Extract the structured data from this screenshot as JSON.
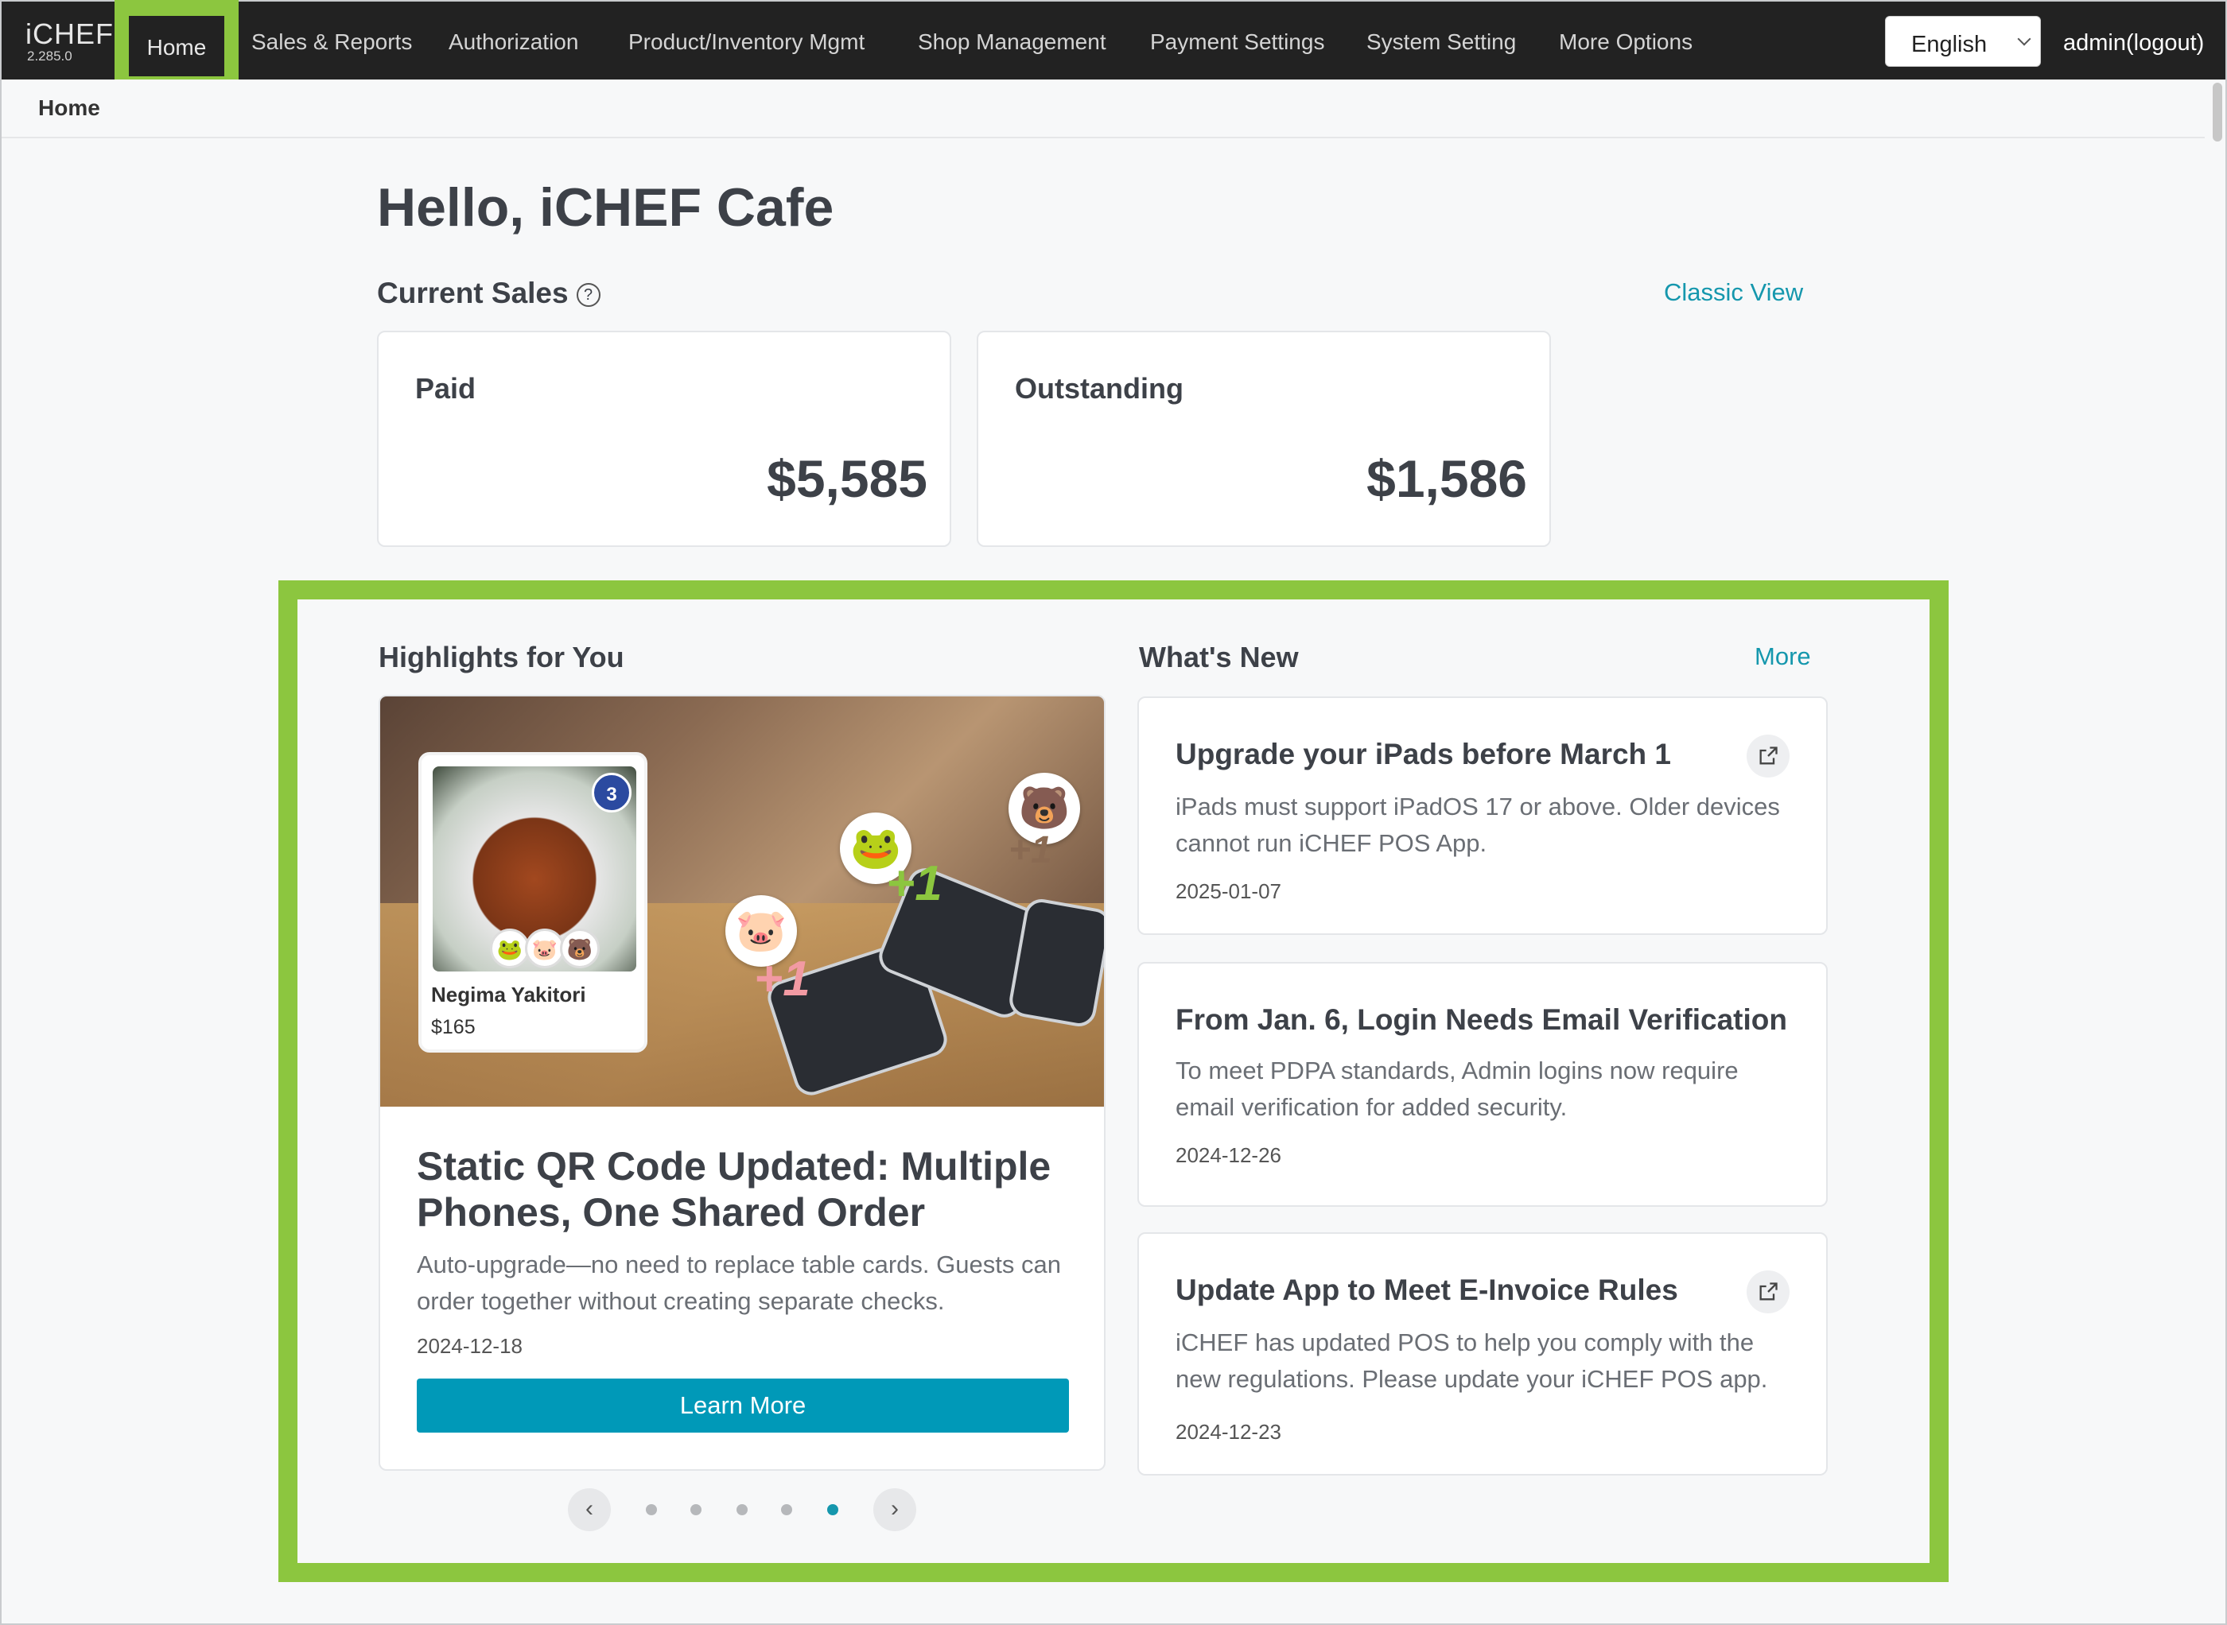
{
  "app": {
    "name": "iCHEF",
    "version": "2.285.0"
  },
  "nav": {
    "home": "Home",
    "items": [
      "Sales & Reports",
      "Authorization",
      "Product/Inventory Mgmt",
      "Shop Management",
      "Payment Settings",
      "System Setting",
      "More Options"
    ],
    "language": "English",
    "user": "admin(logout)"
  },
  "breadcrumb": "Home",
  "greeting": "Hello, iCHEF Cafe",
  "sales": {
    "title": "Current Sales",
    "classic_view": "Classic View",
    "paid_label": "Paid",
    "paid_amount": "$5,585",
    "outstanding_label": "Outstanding",
    "outstanding_amount": "$1,586"
  },
  "highlights": {
    "title": "Highlights for You",
    "image_item_name": "Negima Yakitori",
    "image_item_price": "$165",
    "image_badge": "3",
    "card_title": "Static QR Code Updated: Multiple Phones, One Shared Order",
    "card_desc": "Auto-upgrade—no need to replace table cards. Guests can order together without creating separate checks.",
    "card_date": "2024-12-18",
    "button": "Learn More",
    "carousel": {
      "total": 5,
      "active": 5
    }
  },
  "whats_new": {
    "title": "What's New",
    "more": "More",
    "items": [
      {
        "title": "Upgrade your iPads before March 1",
        "desc": "iPads must support iPadOS 17 or above. Older devices cannot run iCHEF POS App.",
        "date": "2025-01-07",
        "external": true
      },
      {
        "title": "From Jan. 6, Login Needs Email Verification",
        "desc": "To meet PDPA standards, Admin logins now require email verification for added security.",
        "date": "2024-12-26",
        "external": false
      },
      {
        "title": "Update App to Meet E-Invoice Rules",
        "desc": "iCHEF has updated POS to help you comply with the new regulations. Please update your iCHEF POS app.",
        "date": "2024-12-23",
        "external": true
      }
    ]
  },
  "colors": {
    "accent": "#1597ad",
    "button": "#0099b8",
    "highlight": "#8cc63f",
    "nav_bg": "#222222"
  }
}
